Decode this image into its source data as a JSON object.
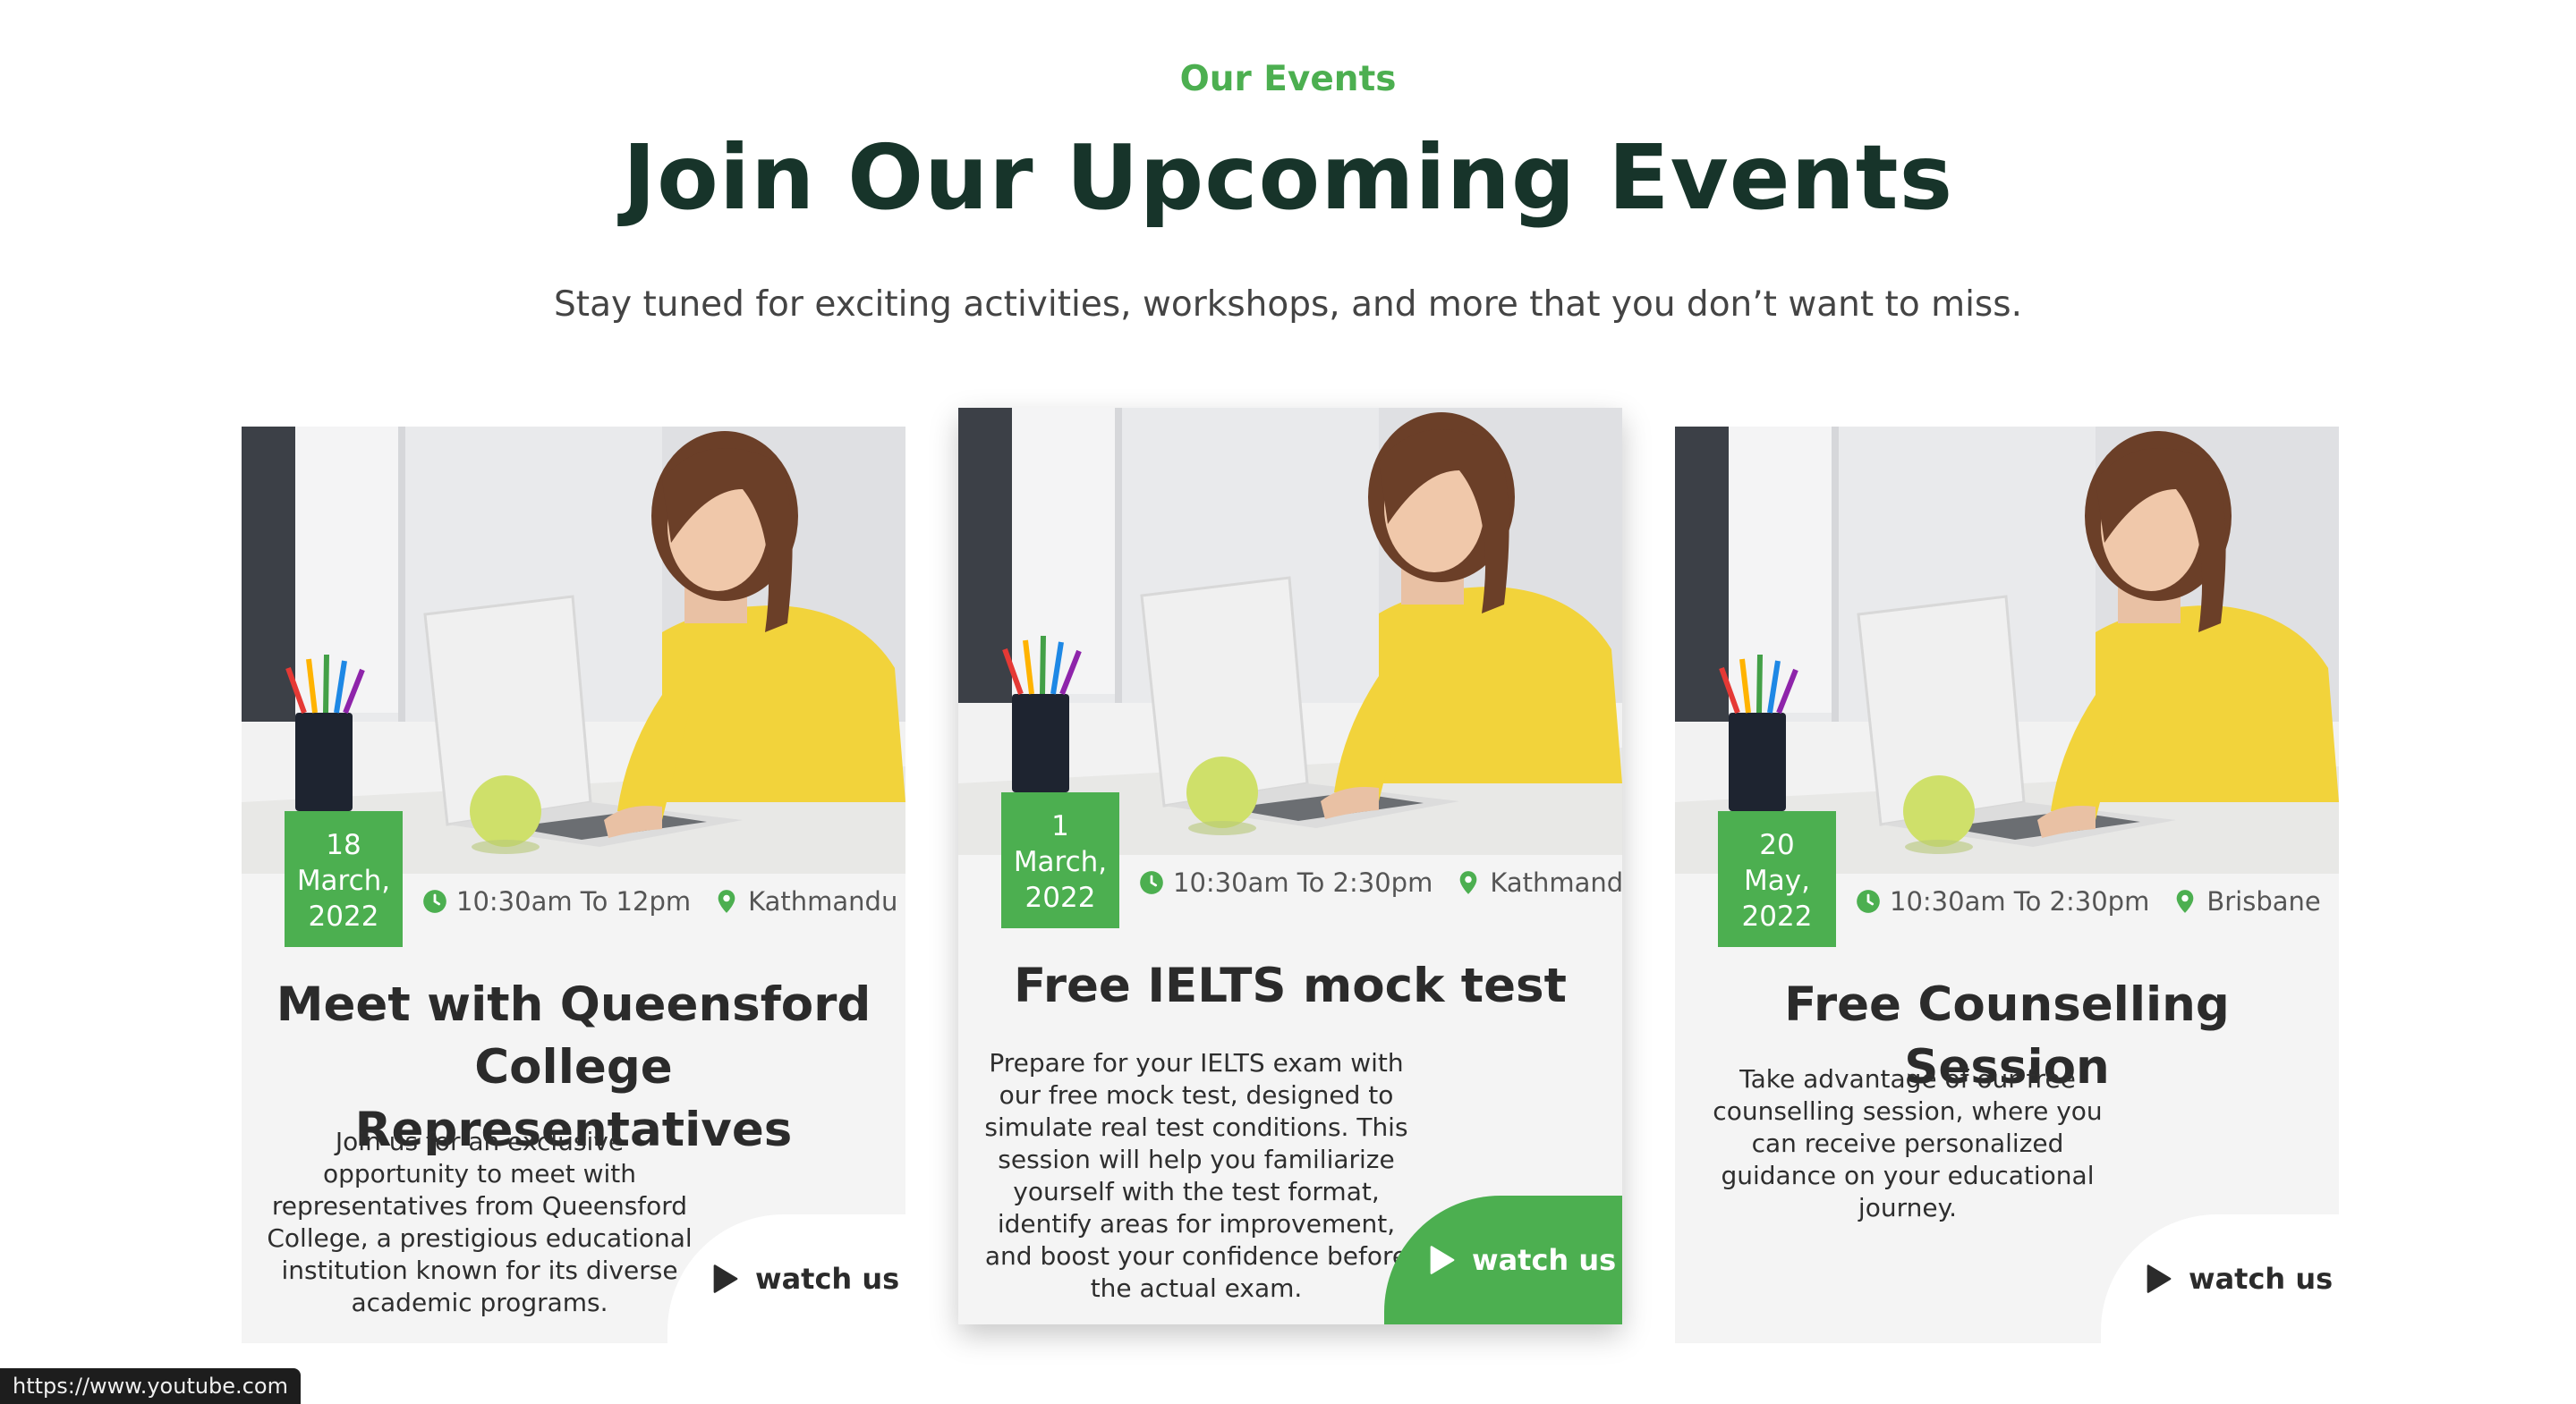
{
  "section": {
    "eyebrow": "Our Events",
    "title": "Join Our Upcoming Events",
    "subtitle": "Stay tuned for exciting activities, workshops, and more that you don’t want to miss."
  },
  "events": [
    {
      "date_line1": "18",
      "date_line2": "March,",
      "date_line3": "2022",
      "time": "10:30am To 12pm",
      "location": "Kathmandu",
      "title": "Meet with Queensford College Representatives",
      "description": "Join us for an exclusive opportunity to meet with representatives from Queensford College, a prestigious educational institution known for its diverse academic programs.",
      "cta": "watch us"
    },
    {
      "date_line1": "1",
      "date_line2": "March,",
      "date_line3": "2022",
      "time": "10:30am To 2:30pm",
      "location": "Kathmandu",
      "title": "Free IELTS mock test",
      "description": "Prepare for your IELTS exam with our free mock test, designed to simulate real test conditions. This session will help you familiarize yourself with the test format, identify areas for improvement, and boost your confidence before the actual exam.",
      "cta": "watch us"
    },
    {
      "date_line1": "20",
      "date_line2": "May,",
      "date_line3": "2022",
      "time": "10:30am To 2:30pm",
      "location": "Brisbane",
      "title": "Free Counselling Session",
      "description": "Take advantage of our free counselling session, where you can receive personalized guidance on your educational journey.",
      "cta": "watch us"
    }
  ],
  "icons": {
    "time": "clock-icon",
    "location": "map-pin-icon",
    "cta": "play-icon"
  },
  "colors": {
    "accent": "#4CAF50",
    "heading": "#17342a",
    "card_bg": "#f4f4f4"
  },
  "status_bar": {
    "url": "https://www.youtube.com"
  }
}
